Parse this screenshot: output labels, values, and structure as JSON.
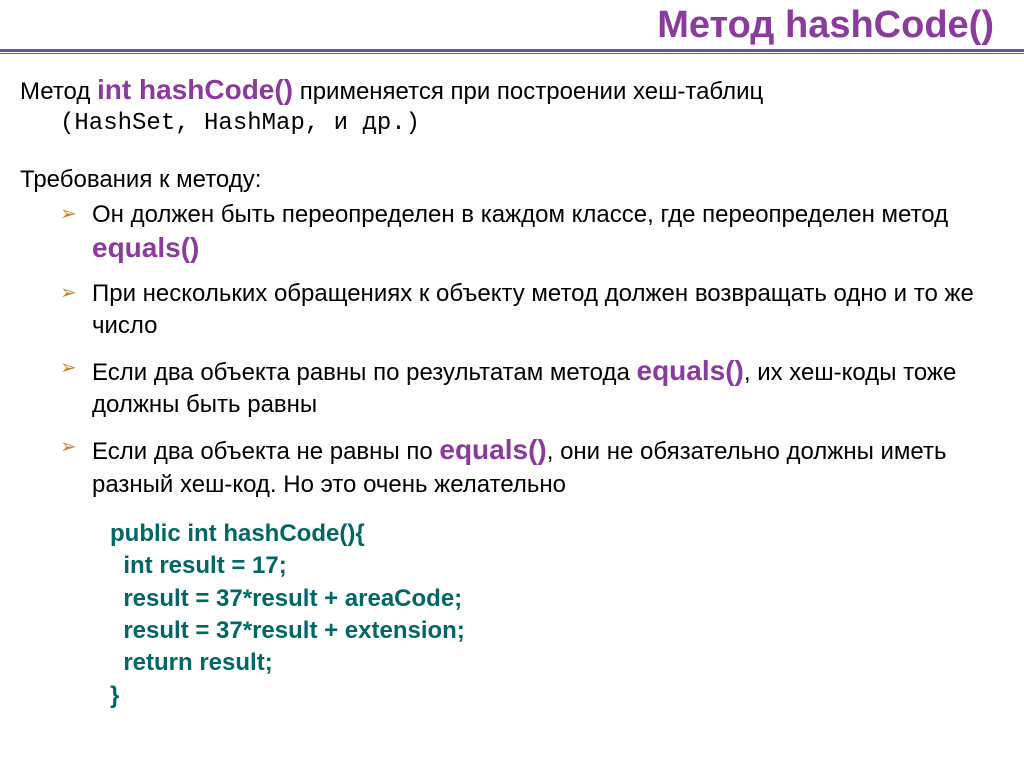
{
  "title": "Метод hashCode()",
  "intro": {
    "pre": "Метод ",
    "method": "int hashCode()",
    "post": " применяется при построении хеш-таблиц",
    "line2": "(HashSet, HashMap, и др.)"
  },
  "req_title": "Требования к методу:",
  "bullets": [
    {
      "t1": "Он должен быть переопределен в каждом классе, где переопределен метод ",
      "em": "equals()",
      "t2": ""
    },
    {
      "t1": "При нескольких обращениях к объекту метод должен возвращать одно и то же число",
      "em": "",
      "t2": ""
    },
    {
      "t1": "Если два объекта равны по результатам метода ",
      "em": "equals()",
      "t2": ", их хеш-коды тоже должны быть равны"
    },
    {
      "t1": "Если два объекта не равны по ",
      "em": "equals()",
      "t2": ", они не обязательно должны иметь разный хеш-код. Но это очень желательно"
    }
  ],
  "code": {
    "l1": "public int hashCode(){",
    "l2": "  int result = 17;",
    "l3": "  result = 37*result + areaCode;",
    "l4": "  result = 37*result + extension;",
    "l5": "  return result;",
    "l6": "}"
  }
}
